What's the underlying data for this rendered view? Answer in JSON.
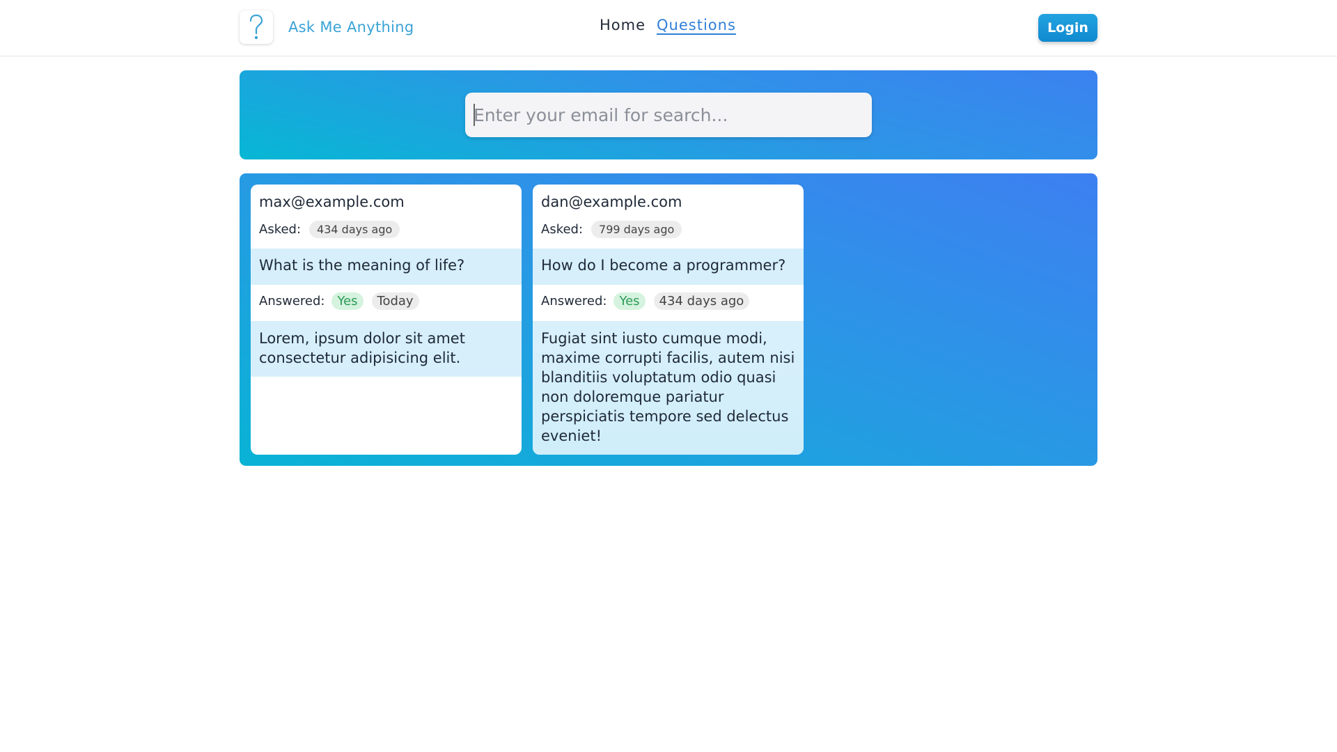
{
  "header": {
    "brand": "Ask Me Anything",
    "logo_icon": "question-mark-icon",
    "nav": {
      "home": "Home",
      "questions": "Questions"
    },
    "login_label": "Login"
  },
  "search": {
    "placeholder": "Enter your email for search...",
    "value": ""
  },
  "questions": [
    {
      "email": "max@example.com",
      "asked_label": "Asked:",
      "asked_when": "434 days ago",
      "question": "What is the meaning of life?",
      "answered_label": "Answered:",
      "answered_status": "Yes",
      "answered_when": "Today",
      "answer": "Lorem, ipsum dolor sit amet consectetur adipisicing elit."
    },
    {
      "email": "dan@example.com",
      "asked_label": "Asked:",
      "asked_when": "799 days ago",
      "question": "How do I become a programmer?",
      "answered_label": "Answered:",
      "answered_status": "Yes",
      "answered_when": "434 days ago",
      "answer": "Fugiat sint iusto cumque modi, maxime corrupti facilis, autem nisi blanditiis voluptatum odio quasi non doloremque pariatur perspiciatis tempore sed delectus eveniet!"
    }
  ],
  "colors": {
    "accent": "#3aa3d6",
    "nav_active": "#2f7fd8",
    "panel_gradient_start": "#07b7d4",
    "panel_gradient_end": "#3b82f0",
    "band": "#d6effb",
    "yes_badge_bg": "#d5f3de",
    "yes_badge_text": "#2d9b58"
  }
}
